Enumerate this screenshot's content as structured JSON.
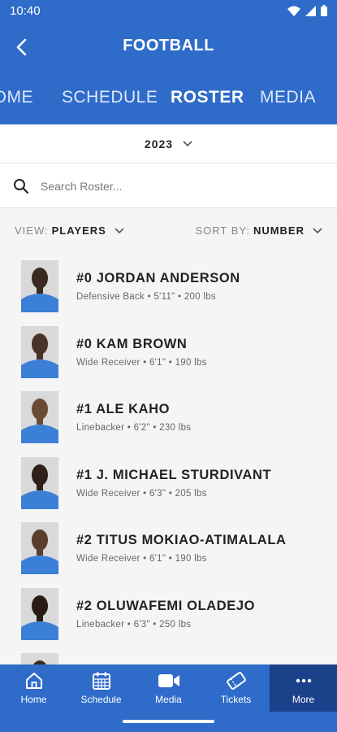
{
  "status": {
    "time": "10:40"
  },
  "header": {
    "title": "FOOTBALL"
  },
  "tabs": [
    {
      "label": "HOME",
      "active": false
    },
    {
      "label": "SCHEDULE",
      "active": false
    },
    {
      "label": "ROSTER",
      "active": true
    },
    {
      "label": "MEDIA",
      "active": false
    }
  ],
  "season": {
    "year": "2023"
  },
  "search": {
    "placeholder": "Search Roster..."
  },
  "filters": {
    "view_label": "VIEW:",
    "view_value": "PLAYERS",
    "sort_label": "SORT BY:",
    "sort_value": "NUMBER"
  },
  "players": [
    {
      "name": "#0 JORDAN ANDERSON",
      "info": "Defensive Back • 5'11\" • 200 lbs"
    },
    {
      "name": "#0 KAM BROWN",
      "info": "Wide Receiver • 6'1\" • 190 lbs"
    },
    {
      "name": "#1 ALE KAHO",
      "info": "Linebacker • 6'2\" • 230 lbs"
    },
    {
      "name": "#1 J. MICHAEL STURDIVANT",
      "info": "Wide Receiver • 6'3\" • 205 lbs"
    },
    {
      "name": "#2 TITUS MOKIAO-ATIMALALA",
      "info": "Wide Receiver • 6'1\" • 190 lbs"
    },
    {
      "name": "#2 OLUWAFEMI OLADEJO",
      "info": "Linebacker • 6'3\" • 250 lbs"
    },
    {
      "name": "",
      "info": ""
    }
  ],
  "bottom_nav": [
    {
      "label": "Home",
      "icon": "home-icon"
    },
    {
      "label": "Schedule",
      "icon": "calendar-icon"
    },
    {
      "label": "Media",
      "icon": "video-camera-icon"
    },
    {
      "label": "Tickets",
      "icon": "ticket-icon"
    },
    {
      "label": "More",
      "icon": "more-dots-icon"
    }
  ],
  "colors": {
    "primary": "#2f6bc9",
    "nav_selected": "#1a4189",
    "jersey": "#3b7fd6"
  }
}
